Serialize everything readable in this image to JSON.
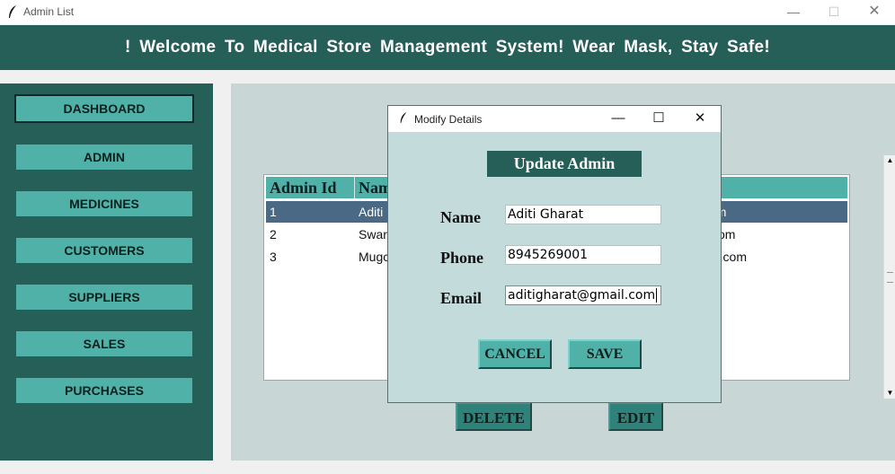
{
  "window": {
    "title": "Admin List",
    "icon": "feather-icon"
  },
  "banner": {
    "text": "!  Welcome To Medical Store Management System! Wear Mask, Stay Safe!"
  },
  "sidebar": {
    "items": [
      {
        "label": "DASHBOARD",
        "active": true
      },
      {
        "label": "ADMIN"
      },
      {
        "label": "MEDICINES"
      },
      {
        "label": "CUSTOMERS"
      },
      {
        "label": "SUPPLIERS"
      },
      {
        "label": "SALES"
      },
      {
        "label": "PURCHASES"
      }
    ]
  },
  "table": {
    "columns": [
      "Admin Id",
      "Nam",
      ""
    ],
    "rows": [
      {
        "id": "1",
        "name": "Aditi",
        "email": "om",
        "selected": true
      },
      {
        "id": "2",
        "name": "Swar",
        "email": "l.com"
      },
      {
        "id": "3",
        "name": "Mugc",
        "email": "mail.com"
      }
    ]
  },
  "actions": {
    "delete_label": "DELETE",
    "edit_label": "EDIT"
  },
  "dialog": {
    "title": "Modify Details",
    "heading": "Update Admin",
    "fields": {
      "name": {
        "label": "Name",
        "value": "Aditi Gharat"
      },
      "phone": {
        "label": "Phone",
        "value": "8945269001"
      },
      "email": {
        "label": "Email",
        "value": "aditigharat@gmail.com"
      }
    },
    "cancel_label": "CANCEL",
    "save_label": "SAVE"
  },
  "colors": {
    "banner": "#265e58",
    "button": "#4fb1a8",
    "panel": "#c8d7d6",
    "dialog": "#c3dcdb",
    "selected_row": "#4a6984"
  }
}
